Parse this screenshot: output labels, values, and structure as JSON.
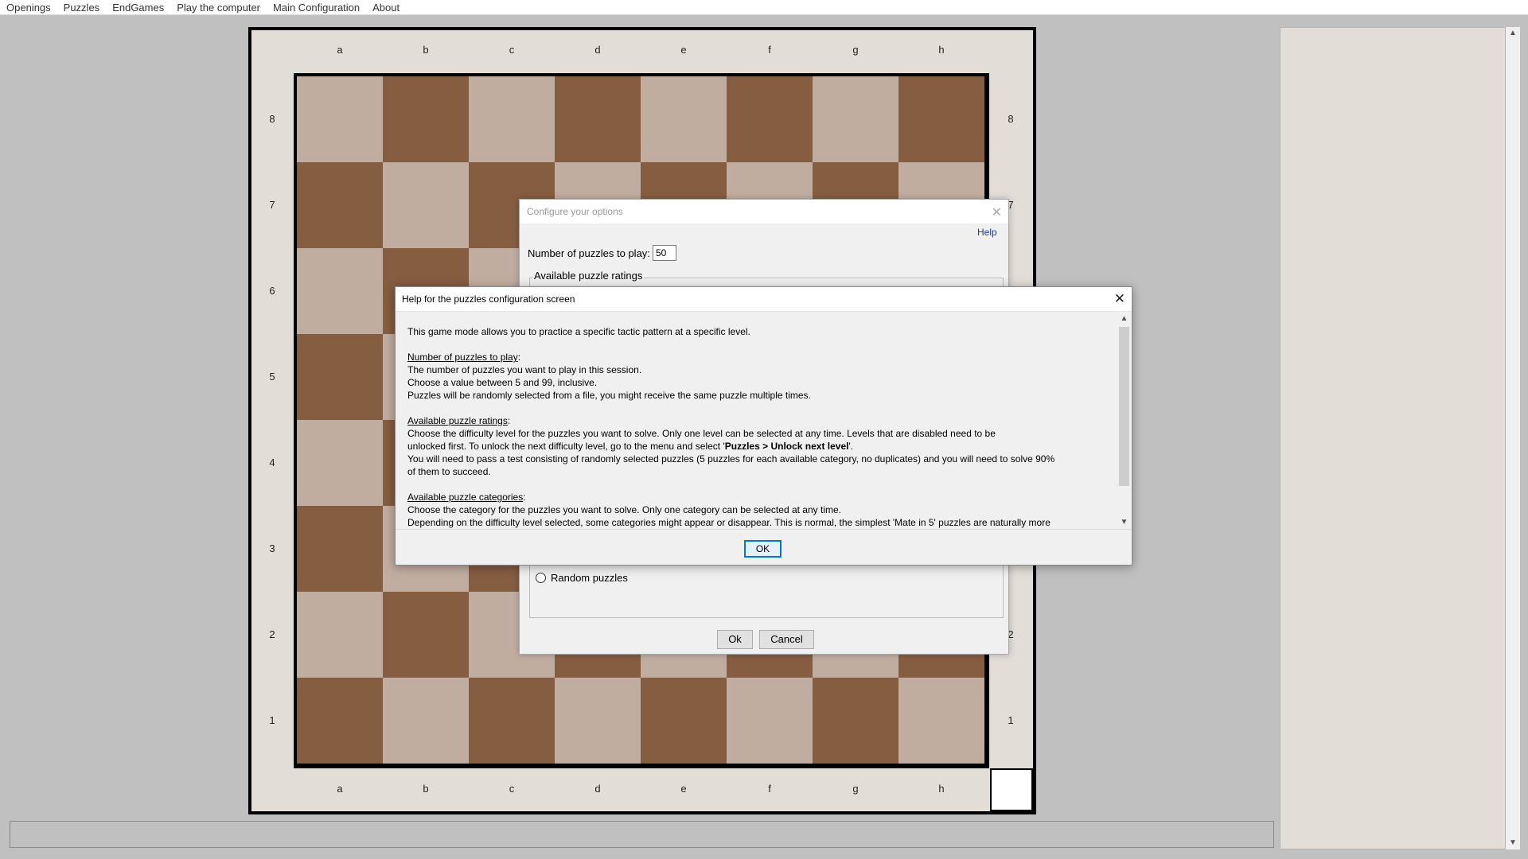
{
  "menu": [
    "Openings",
    "Puzzles",
    "EndGames",
    "Play the computer",
    "Main Configuration",
    "About"
  ],
  "board": {
    "files": [
      "a",
      "b",
      "c",
      "d",
      "e",
      "f",
      "g",
      "h"
    ],
    "ranks": [
      "8",
      "7",
      "6",
      "5",
      "4",
      "3",
      "2",
      "1"
    ],
    "light_color": "#c1ada0",
    "dark_color": "#855d41"
  },
  "config_dialog": {
    "title": "Configure your options",
    "help_link": "Help",
    "num_puzzles_label": "Number of puzzles to play:",
    "num_puzzles_value": "50",
    "ratings_group": "Available puzzle ratings",
    "random_option": "Random puzzles",
    "ok_label": "Ok",
    "cancel_label": "Cancel"
  },
  "help_dialog": {
    "title": "Help for the puzzles configuration screen",
    "intro": "This game mode allows you to practice a specific tactic pattern at a specific level.",
    "sec1_heading": "Number of puzzles to play",
    "sec1_line1": "The number of puzzles you want to play in this session.",
    "sec1_line2": "Choose a value between 5 and 99, inclusive.",
    "sec1_line3": "Puzzles will be randomly selected from a file, you might receive the same puzzle multiple times.",
    "sec2_heading": "Available puzzle ratings",
    "sec2_line1": "Choose the difficulty level for the puzzles you want to solve. Only one level can be selected at any time. Levels that are disabled need to be",
    "sec2_line2_pre": "unlocked first. To unlock the next difficulty level, go to the menu and select '",
    "sec2_line2_bold": "Puzzles > Unlock next level",
    "sec2_line2_post": "'.",
    "sec2_line3": "You will need to pass a test consisting of randomly selected puzzles (5 puzzles for each available category, no duplicates) and you will need to solve 90%",
    "sec2_line4": "of them to succeed.",
    "sec3_heading": "Available puzzle categories",
    "sec3_line1": "Choose the category for the puzzles you want to solve. Only one category can be selected at any time.",
    "sec3_line2": "Depending on the difficulty level selected, some categories might appear or disappear. This is normal, the simplest 'Mate in 5' puzzles are naturally more",
    "ok_label": "OK"
  }
}
